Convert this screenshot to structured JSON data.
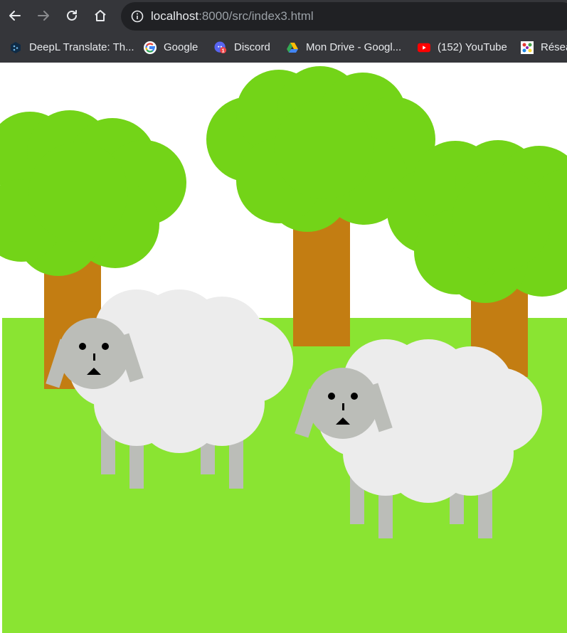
{
  "browser": {
    "url_host": "localhost",
    "url_path": ":8000/src/index3.html",
    "bookmarks": [
      {
        "label": "DeepL Translate: Th...",
        "icon": "deepl-icon"
      },
      {
        "label": "Google",
        "icon": "google-icon"
      },
      {
        "label": "Discord",
        "icon": "discord-icon",
        "badge": "1"
      },
      {
        "label": "Mon Drive - Googl...",
        "icon": "google-drive-icon"
      },
      {
        "label": "(152) YouTube",
        "icon": "youtube-icon"
      },
      {
        "label": "Résea",
        "icon": "network-icon"
      }
    ]
  },
  "colors": {
    "toolbar": "#35363a",
    "omnibox": "#202124",
    "sky": "#ffffff",
    "grass": "#8ae432",
    "foliage": "#73d418",
    "trunk": "#c37d12",
    "wool": "#ececec",
    "sheep_head": "#bbbdb8",
    "sheep_legs": "#bbbdb8",
    "face_features": "#000000"
  },
  "scene": {
    "trees": 3,
    "sheep": 2
  }
}
